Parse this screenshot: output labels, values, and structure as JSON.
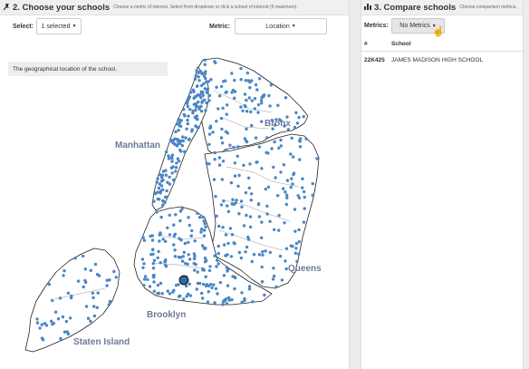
{
  "left_panel": {
    "header": {
      "icon": "pin-icon",
      "title": "2. Choose your schools",
      "subtitle": "Choose a metric of interest. Select from dropdown or click a school of interest (6 maximum)."
    },
    "select_label": "Select:",
    "select_value": "1 selected",
    "metric_label": "Metric:",
    "metric_value": "Location",
    "info_text": "The geographical location of the school."
  },
  "map": {
    "borough_labels": [
      "Manhattan",
      "Bronx",
      "Queens",
      "Brooklyn",
      "Staten Island"
    ],
    "dot_color": "#4a86c5",
    "selected_color": "#2c6ea8",
    "outline_color": "#222222"
  },
  "right_panel": {
    "header": {
      "icon": "bar-chart-icon",
      "title": "3. Compare schools",
      "subtitle": "Choose comparison metrics."
    },
    "metrics_label": "Metrics:",
    "metrics_value": "No Metrics",
    "table": {
      "headers": [
        "#",
        "School"
      ],
      "rows": [
        {
          "id": "22K425",
          "name": "JAMES MADISON HIGH SCHOOL"
        }
      ]
    }
  }
}
